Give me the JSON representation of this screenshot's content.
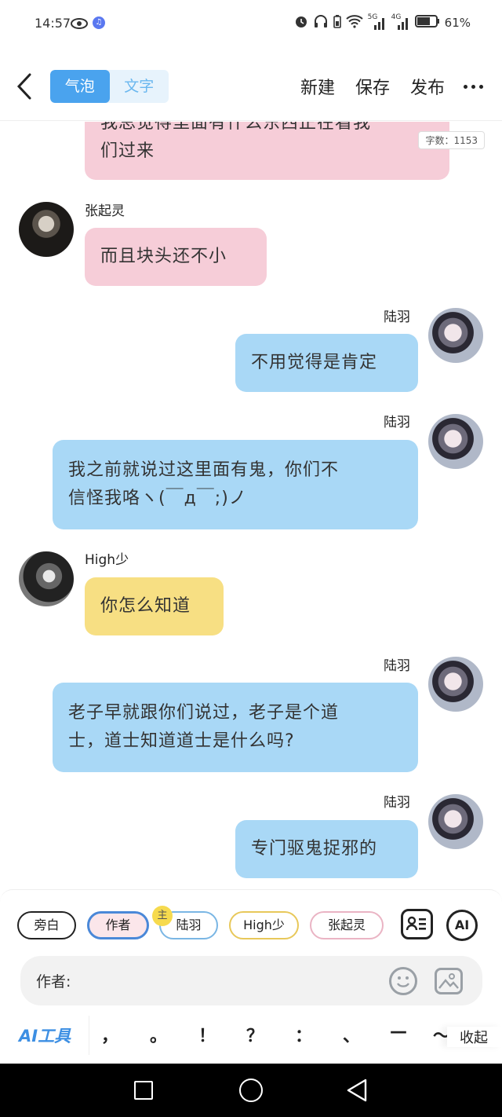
{
  "status_bar": {
    "time": "14:57",
    "network_5g": "5G",
    "network_4g": "4G",
    "battery": "61%"
  },
  "header": {
    "tab_bubble": "气泡",
    "tab_text": "文字",
    "new_label": "新建",
    "save_label": "保存",
    "publish_label": "发布"
  },
  "chat": {
    "word_count": "字数：1153",
    "messages": [
      {
        "speaker": "",
        "lines": [
          "我总觉得里面有什么东西正在看我",
          "们过来"
        ]
      },
      {
        "speaker": "张起灵",
        "lines": [
          "而且块头还不小"
        ]
      },
      {
        "speaker": "陆羽",
        "lines": [
          "不用觉得是肯定"
        ]
      },
      {
        "speaker": "陆羽",
        "lines": [
          "我之前就说过这里面有鬼，你们不",
          "信怪我咯ヽ(￣д￣;)ノ"
        ]
      },
      {
        "speaker": "High少",
        "lines": [
          "你怎么知道"
        ]
      },
      {
        "speaker": "陆羽",
        "lines": [
          "老子早就跟你们说过，老子是个道",
          "士，道士知道道士是什么吗?"
        ]
      },
      {
        "speaker": "陆羽",
        "lines": [
          "专门驱鬼捉邪的"
        ]
      }
    ]
  },
  "role_chips": {
    "narrator": "旁白",
    "author": "作者",
    "host_badge": "主",
    "lu_yu": "陆羽",
    "high_shao": "High少",
    "zhang_qiling": "张起灵",
    "ai": "AI"
  },
  "input": {
    "label": "作者:",
    "value": ""
  },
  "toolbar": {
    "ai_tools": "AI工具",
    "punctuation": [
      "，",
      "。",
      "！",
      "？",
      "：",
      "、",
      "—",
      "～"
    ],
    "collapse": "收起"
  }
}
